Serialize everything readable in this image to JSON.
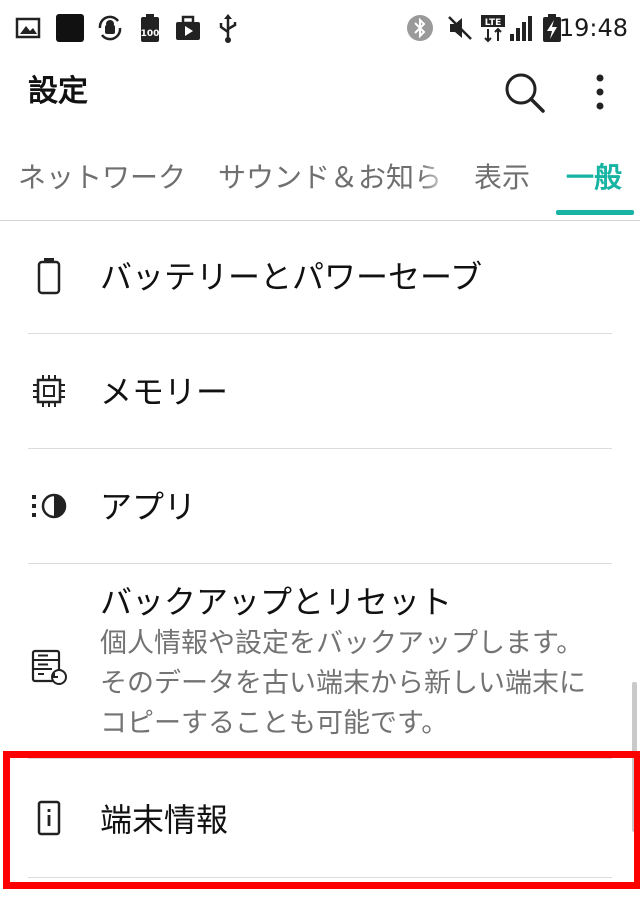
{
  "status_bar": {
    "time": "19:48",
    "left_icons": [
      "image-icon",
      "black-square-icon",
      "android-sync-icon",
      "battery-100-icon",
      "briefcase-play-icon",
      "usb-icon"
    ],
    "right_icons": [
      "bluetooth-icon",
      "mute-icon",
      "lte-icon",
      "signal-icon",
      "battery-charging-icon"
    ],
    "lte_label": "LTE",
    "battery_label": "100"
  },
  "app_bar": {
    "title": "設定",
    "actions": [
      "search-icon",
      "more-vert-icon"
    ]
  },
  "tabs": [
    {
      "label": "ネットワーク",
      "active": false
    },
    {
      "label": "サウンド＆お知ら",
      "active": false
    },
    {
      "label": "表示",
      "active": false
    },
    {
      "label": "一般",
      "active": true
    }
  ],
  "accent_color": "#17b3a3",
  "highlight_color": "#ff0000",
  "items": [
    {
      "icon": "battery-icon",
      "title": "バッテリーとパワーセーブ"
    },
    {
      "icon": "memory-chip-icon",
      "title": "メモリー"
    },
    {
      "icon": "apps-icon",
      "title": "アプリ"
    },
    {
      "icon": "backup-restore-icon",
      "title": "バックアップとリセット",
      "summary": [
        "個人情報や設定をバックアップします。",
        "そのデータを古い端末から新しい端末に",
        "コピーすることも可能です。"
      ]
    },
    {
      "icon": "info-icon",
      "title": "端末情報",
      "highlighted": true
    }
  ]
}
